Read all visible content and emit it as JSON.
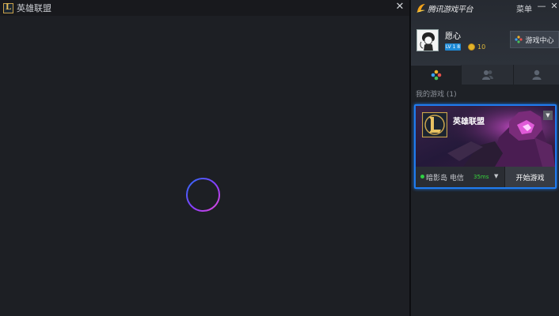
{
  "game_window": {
    "title": "英雄联盟",
    "close_glyph": "✕",
    "logo_letter": "L",
    "spinner_colors": [
      "#1f6cf5",
      "#8b3cff",
      "#e04ad8"
    ]
  },
  "platform": {
    "brand_name": "腾讯游戏平台",
    "menu_label": "菜单",
    "minimize_glyph": "—",
    "close_glyph": "✕",
    "user": {
      "name": "愿心",
      "level": "LV 1 8",
      "coins": "10"
    },
    "game_center_label": "游戏中心",
    "tabs": [
      {
        "icon": "gamepad-icon",
        "active": true
      },
      {
        "icon": "friends-icon",
        "active": false
      },
      {
        "icon": "person-icon",
        "active": false
      }
    ],
    "my_games_label": "我的游戏 (1)",
    "game_card": {
      "title": "英雄联盟",
      "logo_letter": "L",
      "server": "暗影岛 电信",
      "ping": "35ms",
      "start_label": "开始游戏",
      "status_color": "#2ed143",
      "accent": "#1f7cf0"
    }
  }
}
